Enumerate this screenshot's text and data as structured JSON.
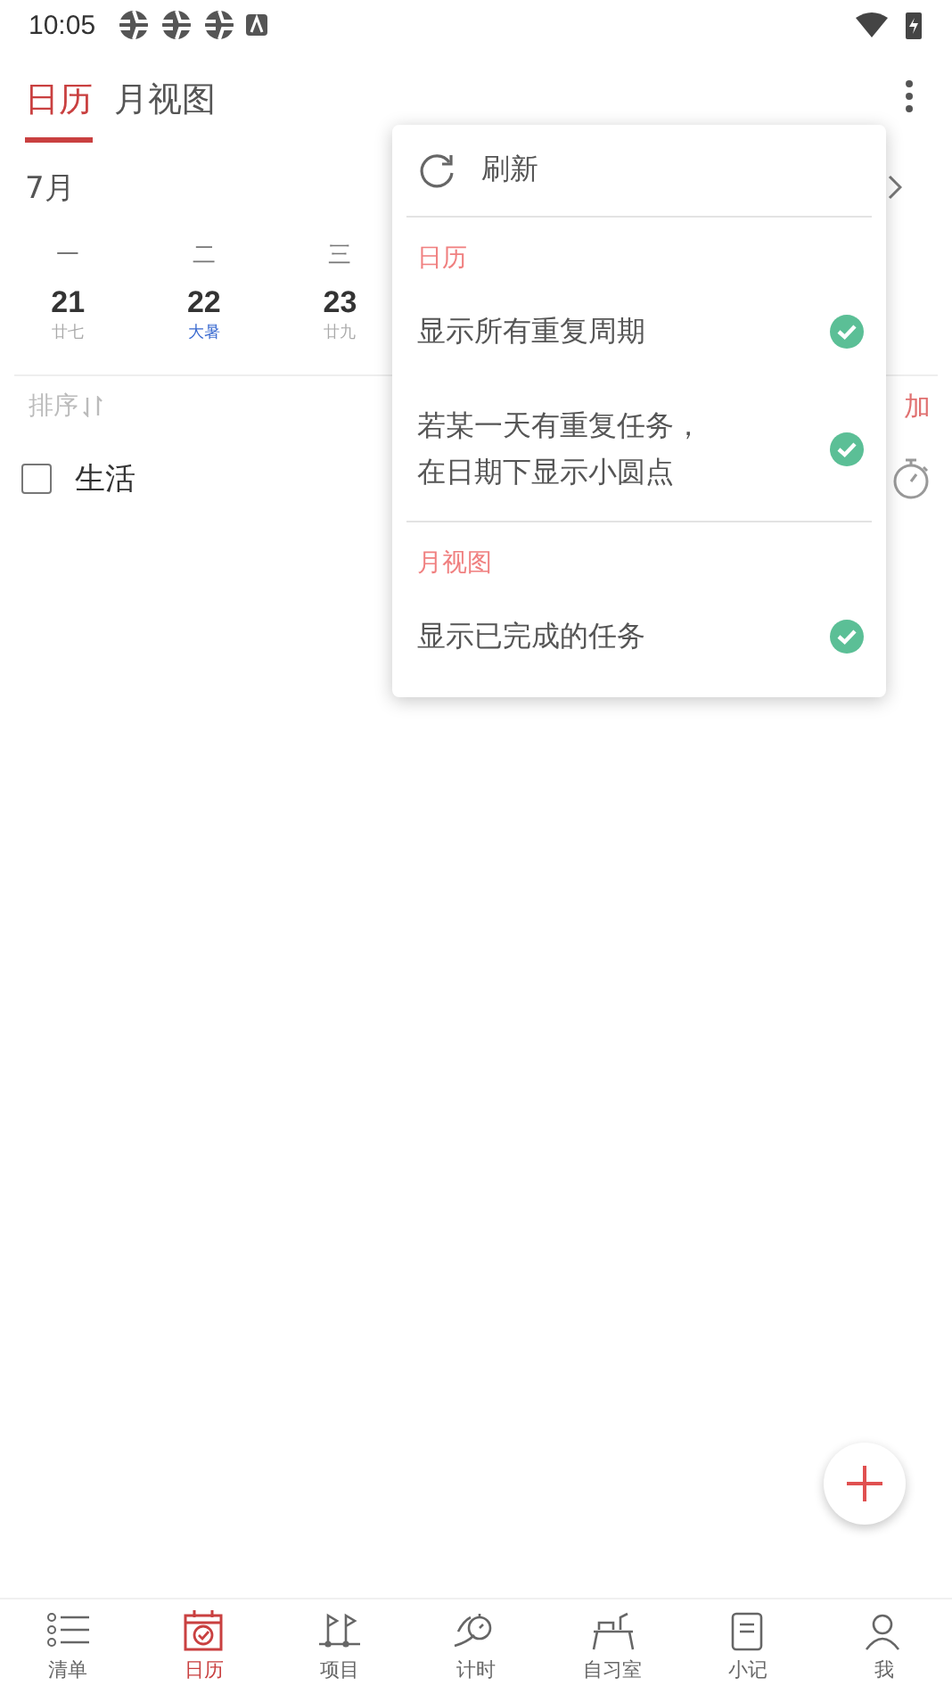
{
  "status_bar": {
    "time": "10:05"
  },
  "header": {
    "tabs": [
      {
        "label": "日历",
        "selected": true
      },
      {
        "label": "月视图",
        "selected": false
      }
    ]
  },
  "calendar": {
    "month": "7月",
    "weekdays": [
      "一",
      "二",
      "三"
    ],
    "days": [
      {
        "date": "21",
        "lunar": "廿七",
        "festival": false
      },
      {
        "date": "22",
        "lunar": "大暑",
        "festival": true
      },
      {
        "date": "23",
        "lunar": "廿九",
        "festival": false
      }
    ]
  },
  "toolbar": {
    "sort": "排序",
    "add": "加"
  },
  "tasks": [
    {
      "title": "生活",
      "checked": false
    }
  ],
  "menu": {
    "items": [
      {
        "kind": "action",
        "label": "刷新"
      },
      {
        "kind": "header",
        "label": "日历"
      },
      {
        "kind": "toggle",
        "label": "显示所有重复周期",
        "checked": true
      },
      {
        "kind": "toggle",
        "label": "若某一天有重复任务，在日期下显示小圆点",
        "checked": true
      },
      {
        "kind": "header",
        "label": "月视图"
      },
      {
        "kind": "toggle",
        "label": "显示已完成的任务",
        "checked": true
      }
    ]
  },
  "bottom_nav": [
    {
      "label": "清单",
      "selected": false
    },
    {
      "label": "日历",
      "selected": true
    },
    {
      "label": "项目",
      "selected": false
    },
    {
      "label": "计时",
      "selected": false
    },
    {
      "label": "自习室",
      "selected": false
    },
    {
      "label": "小记",
      "selected": false
    },
    {
      "label": "我",
      "selected": false
    }
  ]
}
